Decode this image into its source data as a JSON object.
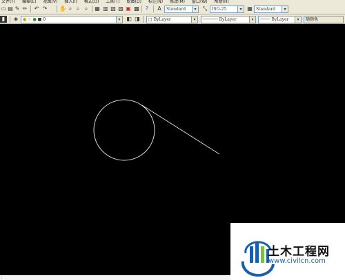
{
  "menubar": {
    "items": [
      {
        "label": "文件(F)"
      },
      {
        "label": "编辑(E)"
      },
      {
        "label": "视图(V)"
      },
      {
        "label": "插入(I)"
      },
      {
        "label": "格式(O)"
      },
      {
        "label": "工具(T)"
      },
      {
        "label": "绘图(D)"
      },
      {
        "label": "标注(N)"
      },
      {
        "label": "修改(M)"
      },
      {
        "label": "窗口(W)"
      },
      {
        "label": "帮助(H)"
      }
    ]
  },
  "styles_toolbar": {
    "text_style": "Standard",
    "dim_style": "ISO-25",
    "table_style": "Standard"
  },
  "layers_toolbar": {
    "current_layer": "0",
    "color": "ByLayer",
    "linetype": "ByLayer",
    "lineweight": "ByLayer",
    "plot_style": "随颜色"
  },
  "watermark": {
    "title": "土木工程网",
    "url": "www.civilcn.com"
  },
  "colors": {
    "toolbar_bg": "#ece9d8",
    "canvas_bg": "#000000",
    "drawing": "#d8d8d8",
    "logo_blue": "#1a5fa8",
    "logo_green": "#7ac143"
  }
}
